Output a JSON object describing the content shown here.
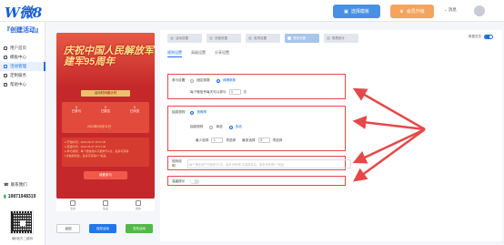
{
  "topbar": {
    "logo": "微8",
    "template_button": "选择模板",
    "upgrade_button": "会员升级",
    "message": "消息"
  },
  "sidebar": {
    "title": "『创建活动』",
    "items": [
      {
        "label": "用户首页",
        "active": false
      },
      {
        "label": "模板中心",
        "active": false
      },
      {
        "label": "活动管理",
        "active": true
      },
      {
        "label": "定制服务",
        "active": false
      },
      {
        "label": "帮助中心",
        "active": false
      }
    ],
    "contact": "联系我们",
    "phone": "19871948319",
    "qr_label": "微8官方二维码"
  },
  "preview": {
    "title_line1": "庆祝中国人民解放军",
    "title_line2": "建军95周年",
    "subbar": "活动时间倒计时",
    "stats": [
      {
        "value": "0",
        "label": "已参与"
      },
      {
        "value": "0",
        "label": "已报名"
      },
      {
        "value": "0",
        "label": "已浏览"
      }
    ],
    "time": "2024年05月01日",
    "info_lines": [
      "● 开始时间：2024.05.27 15:07:45",
      "● 结束时间：2024.06.27 15:07:45",
      "● 参与规则：每个微信用户只能参与1次，最多可获得",
      "   1次抽奖机会，最多可获得1个奖品"
    ],
    "join_button": "我要参与",
    "nav": [
      "活动",
      "奖品",
      "我的"
    ]
  },
  "bottom_buttons": {
    "back": "返回",
    "save": "保存活动",
    "publish": "发布活动"
  },
  "panel": {
    "steps": [
      "活动设置",
      "页面设置",
      "奖项设置",
      "规则设置",
      "报表统计"
    ],
    "active_step": 3,
    "top_toggle_label": "数据总览",
    "subtabs": [
      "规则设置",
      "高级设置",
      "分享设置"
    ],
    "participation": {
      "label": "参与设置",
      "option1": "固定参数",
      "option2": "间隔参数",
      "sub_label": "每个微信号每天可以参与",
      "value": "1",
      "unit": "次"
    },
    "draw": {
      "label": "抽奖规则",
      "option": "按概率",
      "sub_label": "抽奖规则",
      "choice1": "单选",
      "choice2": "多选",
      "min_label": "最少选择",
      "min_value": "1",
      "min_unit": "项选择",
      "max_label": "最多选择",
      "max_value": "3",
      "max_unit": "项选择"
    },
    "rules": {
      "label": "规则说明",
      "placeholder": "每个微信用户只能参与1次，最多可获得1次抽奖机会，最多可获得1个奖品"
    },
    "tips": {
      "label": "温馨提示"
    }
  },
  "colors": {
    "accent": "#1f6fe0",
    "highlight_box": "#e54848",
    "preview_bg": "#c5282a"
  }
}
